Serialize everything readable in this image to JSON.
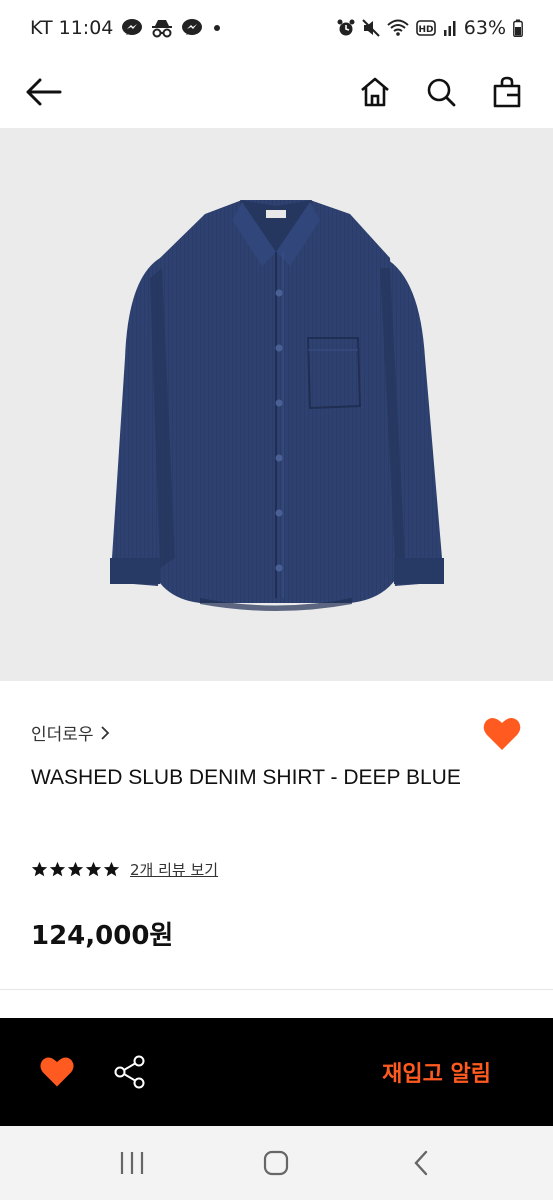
{
  "status_bar": {
    "carrier_time": "KT 11:04",
    "battery": "63%",
    "left_icons": [
      "messenger-icon",
      "incognito-icon",
      "messenger-icon",
      "dot-icon"
    ],
    "right_icons": [
      "alarm-icon",
      "mute-icon",
      "wifi-icon",
      "hd-icon",
      "signal-icon",
      "battery-icon"
    ]
  },
  "nav": {
    "icons": [
      "back-arrow-icon",
      "home-icon",
      "search-icon",
      "shopping-bag-icon"
    ]
  },
  "product": {
    "brand": "인더로우",
    "brand_chevron": "chevron-right-icon",
    "name": "WASHED SLUB DENIM SHIRT - DEEP BLUE",
    "rating": 5,
    "review_link": "2개 리뷰 보기",
    "price": "124,000원",
    "wishlisted": true
  },
  "action_bar": {
    "restock_label": "재입고 알림",
    "icons": [
      "heart-icon",
      "share-icon"
    ]
  },
  "colors": {
    "accent": "#ff5a1f",
    "action_bar_bg": "#000000",
    "hero_bg": "#ebebeb",
    "denim": "#2b3f6a"
  },
  "system_nav": {
    "icons": [
      "recent-apps-icon",
      "home-button-icon",
      "back-icon"
    ]
  }
}
